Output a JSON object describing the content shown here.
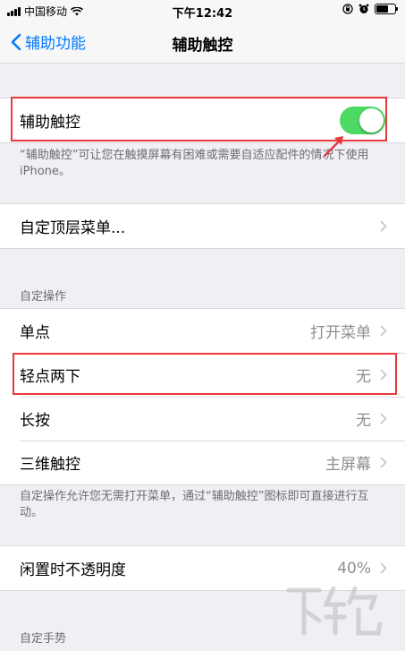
{
  "status_bar": {
    "carrier": "中国移动",
    "time": "下午12:42",
    "battery_level": 0.7
  },
  "nav": {
    "back_label": "辅助功能",
    "title": "辅助功能"
  },
  "assistive_touch": {
    "label": "辅助触控",
    "enabled": true,
    "description": "“辅助触控”可让您在触摸屏幕有困难或需要自适应配件的情况下使用 iPhone。"
  },
  "top_menu": {
    "label": "自定顶层菜单..."
  },
  "custom_actions": {
    "header": "自定操作",
    "items": [
      {
        "label": "单点",
        "value": "打开菜单"
      },
      {
        "label": "轻点两下",
        "value": "无"
      },
      {
        "label": "长按",
        "value": "无"
      },
      {
        "label": "三维触控",
        "value": "主屏幕"
      }
    ],
    "footer": "自定操作允许您无需打开菜单，通过“辅助触控”图标即可直接进行互动。"
  },
  "idle_opacity": {
    "label": "闲置时不透明度",
    "value": "40%"
  },
  "custom_gestures": {
    "header": "自定手势"
  },
  "colors": {
    "accent": "#007aff",
    "toggle_on": "#4cd964",
    "highlight": "#e8383d"
  }
}
